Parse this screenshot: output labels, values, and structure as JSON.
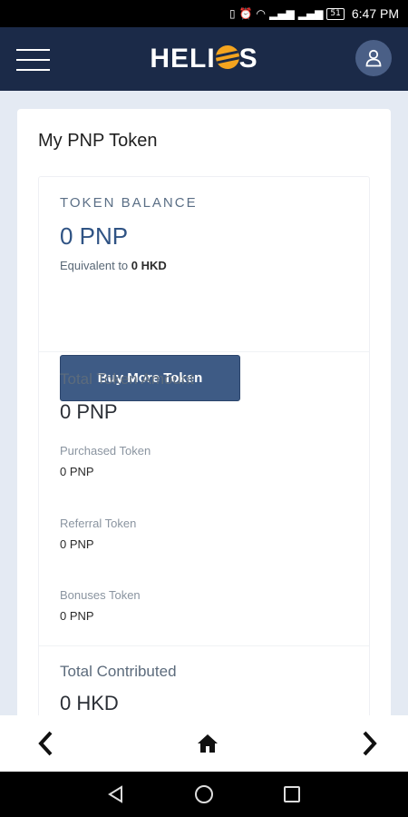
{
  "status_bar": {
    "time": "6:47 PM",
    "battery": "51"
  },
  "header": {
    "logo_text_left": "HELI",
    "logo_text_right": "S"
  },
  "card": {
    "title": "My PNP Token",
    "token_balance": {
      "label": "TOKEN BALANCE",
      "value": "0 PNP",
      "equivalent_prefix": "Equivalent to",
      "equivalent_value": "0 HKD"
    },
    "buy_button": "Buy More Token",
    "total_token": {
      "label": "Total Token Amount",
      "value": "0 PNP",
      "items": [
        {
          "label": "Purchased Token",
          "value": "0 PNP"
        },
        {
          "label": "Referral Token",
          "value": "0 PNP"
        },
        {
          "label": "Bonuses Token",
          "value": "0 PNP"
        }
      ]
    },
    "total_contributed": {
      "label": "Total Contributed",
      "value": "0 HKD"
    }
  },
  "colors": {
    "header_bg": "#1b2a48",
    "accent": "#f4a41f",
    "button_bg": "#3e5b85",
    "balance_text": "#2f5384"
  }
}
